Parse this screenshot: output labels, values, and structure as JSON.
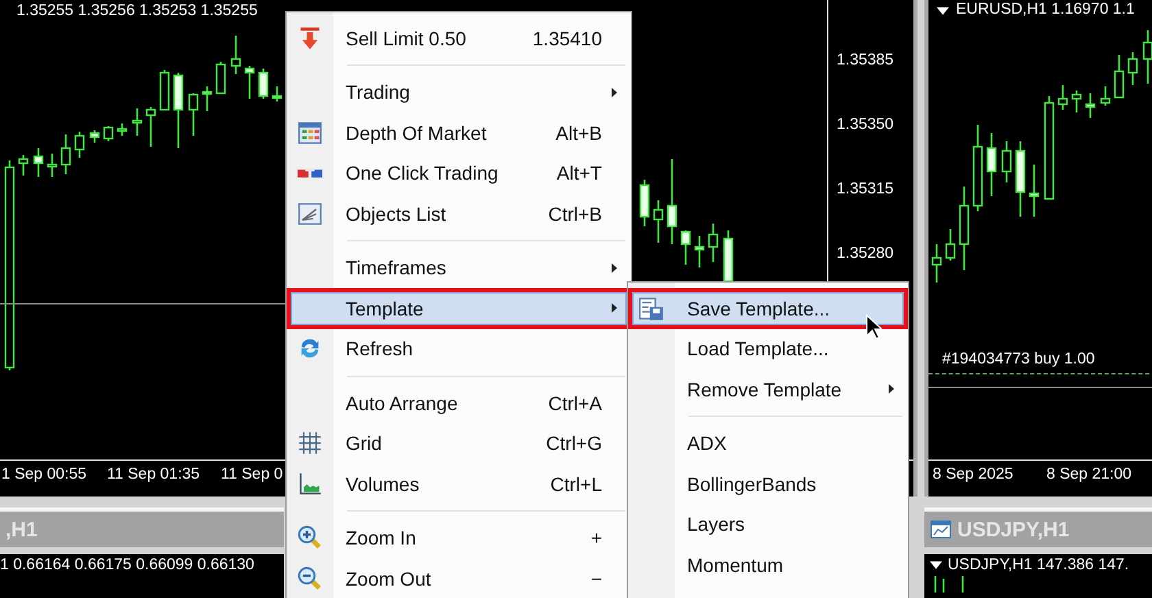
{
  "charts": [
    {
      "header": "1.35255 1.35256 1.35253 1.35255",
      "price_labels": [
        "1.35385",
        "1.35350",
        "1.35315",
        "1.35280"
      ],
      "time_labels": [
        "1 Sep 00:55",
        "11 Sep 01:35",
        "11 Sep 0"
      ]
    },
    {
      "header": "EURUSD,H1  1.16970 1.1",
      "order_label": "#194034773 buy 1.00",
      "time_labels": [
        "8 Sep 2025",
        "8 Sep 21:00"
      ]
    }
  ],
  "bottom_windows": [
    {
      "title": ",H1",
      "header": "1 0.66164 0.66175 0.66099 0.66130"
    },
    {
      "title": "USDJPY,H1",
      "header": "USDJPY,H1  147.386 147."
    }
  ],
  "context_menu": {
    "items": [
      {
        "kind": "item",
        "label": "Sell Limit 0.50",
        "shortcut": "1.35410",
        "submenu": false,
        "selected": false
      },
      {
        "kind": "separator"
      },
      {
        "kind": "item",
        "label": "Trading",
        "submenu": true,
        "selected": false
      },
      {
        "kind": "item",
        "label": "Depth Of Market",
        "shortcut": "Alt+B",
        "submenu": false,
        "selected": false
      },
      {
        "kind": "item",
        "label": "One Click Trading",
        "shortcut": "Alt+T",
        "submenu": false,
        "selected": false
      },
      {
        "kind": "item",
        "label": "Objects List",
        "shortcut": "Ctrl+B",
        "submenu": false,
        "selected": false
      },
      {
        "kind": "separator"
      },
      {
        "kind": "item",
        "label": "Timeframes",
        "submenu": true,
        "selected": false
      },
      {
        "kind": "item",
        "label": "Template",
        "submenu": true,
        "selected": true
      },
      {
        "kind": "item",
        "label": "Refresh",
        "submenu": false,
        "selected": false
      },
      {
        "kind": "separator"
      },
      {
        "kind": "item",
        "label": "Auto Arrange",
        "shortcut": "Ctrl+A",
        "submenu": false,
        "selected": false
      },
      {
        "kind": "item",
        "label": "Grid",
        "shortcut": "Ctrl+G",
        "submenu": false,
        "selected": false
      },
      {
        "kind": "item",
        "label": "Volumes",
        "shortcut": "Ctrl+L",
        "submenu": false,
        "selected": false
      },
      {
        "kind": "separator"
      },
      {
        "kind": "item",
        "label": "Zoom In",
        "shortcut": "+",
        "submenu": false,
        "selected": false
      },
      {
        "kind": "item",
        "label": "Zoom Out",
        "shortcut": "−",
        "submenu": false,
        "selected": false
      }
    ]
  },
  "submenu": {
    "items": [
      {
        "kind": "item",
        "label": "Save Template...",
        "submenu": false,
        "selected": true
      },
      {
        "kind": "item",
        "label": "Load Template...",
        "submenu": false,
        "selected": false
      },
      {
        "kind": "item",
        "label": "Remove Template",
        "submenu": true,
        "selected": false
      },
      {
        "kind": "separator"
      },
      {
        "kind": "item",
        "label": "ADX",
        "submenu": false,
        "selected": false
      },
      {
        "kind": "item",
        "label": "BollingerBands",
        "submenu": false,
        "selected": false
      },
      {
        "kind": "item",
        "label": "Layers",
        "submenu": false,
        "selected": false
      },
      {
        "kind": "item",
        "label": "Momentum",
        "submenu": false,
        "selected": false
      }
    ]
  }
}
